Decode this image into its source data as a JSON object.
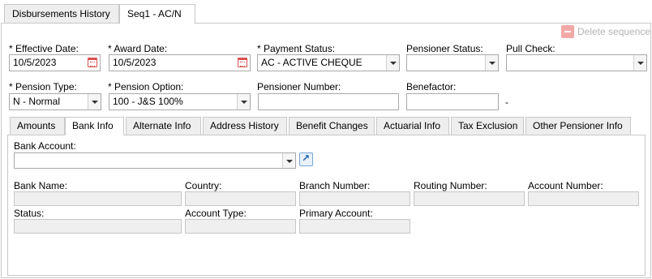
{
  "tabs": {
    "disbursements": "Disbursements History",
    "seq1": "Seq1 - AC/N"
  },
  "toolbar": {
    "delete_sequence": "Delete sequence"
  },
  "form": {
    "effective_date_label": "* Effective Date:",
    "effective_date_value": "10/5/2023",
    "award_date_label": "* Award Date:",
    "award_date_value": "10/5/2023",
    "payment_status_label": "* Payment Status:",
    "payment_status_value": "AC - ACTIVE CHEQUE",
    "pensioner_status_label": "Pensioner Status:",
    "pensioner_status_value": "",
    "pull_check_label": "Pull Check:",
    "pull_check_value": "",
    "pension_type_label": "* Pension Type:",
    "pension_type_value": "N - Normal",
    "pension_option_label": "* Pension Option:",
    "pension_option_value": "100 - J&S 100%",
    "pensioner_number_label": "Pensioner Number:",
    "pensioner_number_value": "",
    "benefactor_label": "Benefactor:",
    "benefactor_value": "",
    "benefactor_suffix": "-"
  },
  "inner_tabs": {
    "amounts": "Amounts",
    "bank_info": "Bank Info",
    "alternate_info": "Alternate Info",
    "address_history": "Address History",
    "benefit_changes": "Benefit Changes",
    "actuarial_info": "Actuarial Info",
    "tax_exclusion": "Tax Exclusion",
    "other_pensioner_info": "Other Pensioner Info"
  },
  "bank": {
    "bank_account_label": "Bank Account:",
    "bank_account_value": "",
    "bank_name_label": "Bank Name:",
    "country_label": "Country:",
    "branch_number_label": "Branch Number:",
    "routing_number_label": "Routing Number:",
    "account_number_label": "Account Number:",
    "status_label": "Status:",
    "account_type_label": "Account Type:",
    "primary_account_label": "Primary Account:"
  }
}
